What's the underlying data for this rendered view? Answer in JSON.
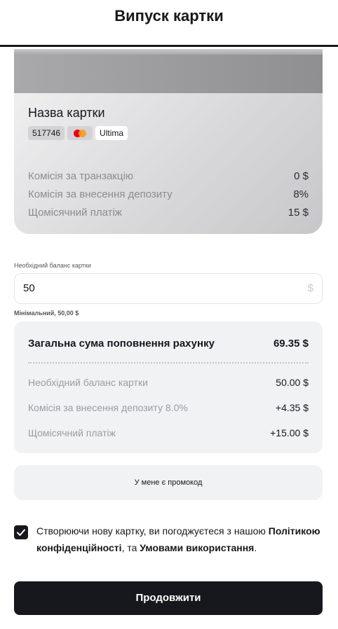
{
  "header": {
    "title": "Випуск картки"
  },
  "card": {
    "name": "Назва картки",
    "chips": {
      "number": "517746",
      "brand_icon": "mastercard-icon",
      "tier": "Ultima"
    },
    "fees": [
      {
        "label": "Комісія за транзакцію",
        "value": "0 $"
      },
      {
        "label": "Комісія за внесення депозиту",
        "value": "8%"
      },
      {
        "label": "Щомісячний платіж",
        "value": "15 $"
      }
    ]
  },
  "balance": {
    "label": "Необхідний баланс картки",
    "value": "50",
    "suffix": "$",
    "hint": "Мінімальний, 50,00 $"
  },
  "summary": {
    "total_label": "Загальна сума поповнення рахунку",
    "total_value": "69.35 $",
    "rows": [
      {
        "label": "Необхідний баланс картки",
        "value": "50.00 $"
      },
      {
        "label": "Комісія за внесення депозиту 8.0%",
        "value": "+4.35 $"
      },
      {
        "label": "Щомісячний платіж",
        "value": "+15.00 $"
      }
    ]
  },
  "promo": {
    "label": "У мене є промокод"
  },
  "agreement": {
    "checked": true,
    "text_1": "Створюючи нову картку, ви погоджуєтеся з нашою ",
    "privacy_link": "Політикою конфіденційності",
    "text_2": ", та ",
    "terms_link": "Умовами використання",
    "text_3": "."
  },
  "cta": {
    "label": "Продовжити"
  },
  "colors": {
    "primary": "#16181d",
    "surface": "#f1f2f4",
    "muted": "#9b9ca0"
  }
}
